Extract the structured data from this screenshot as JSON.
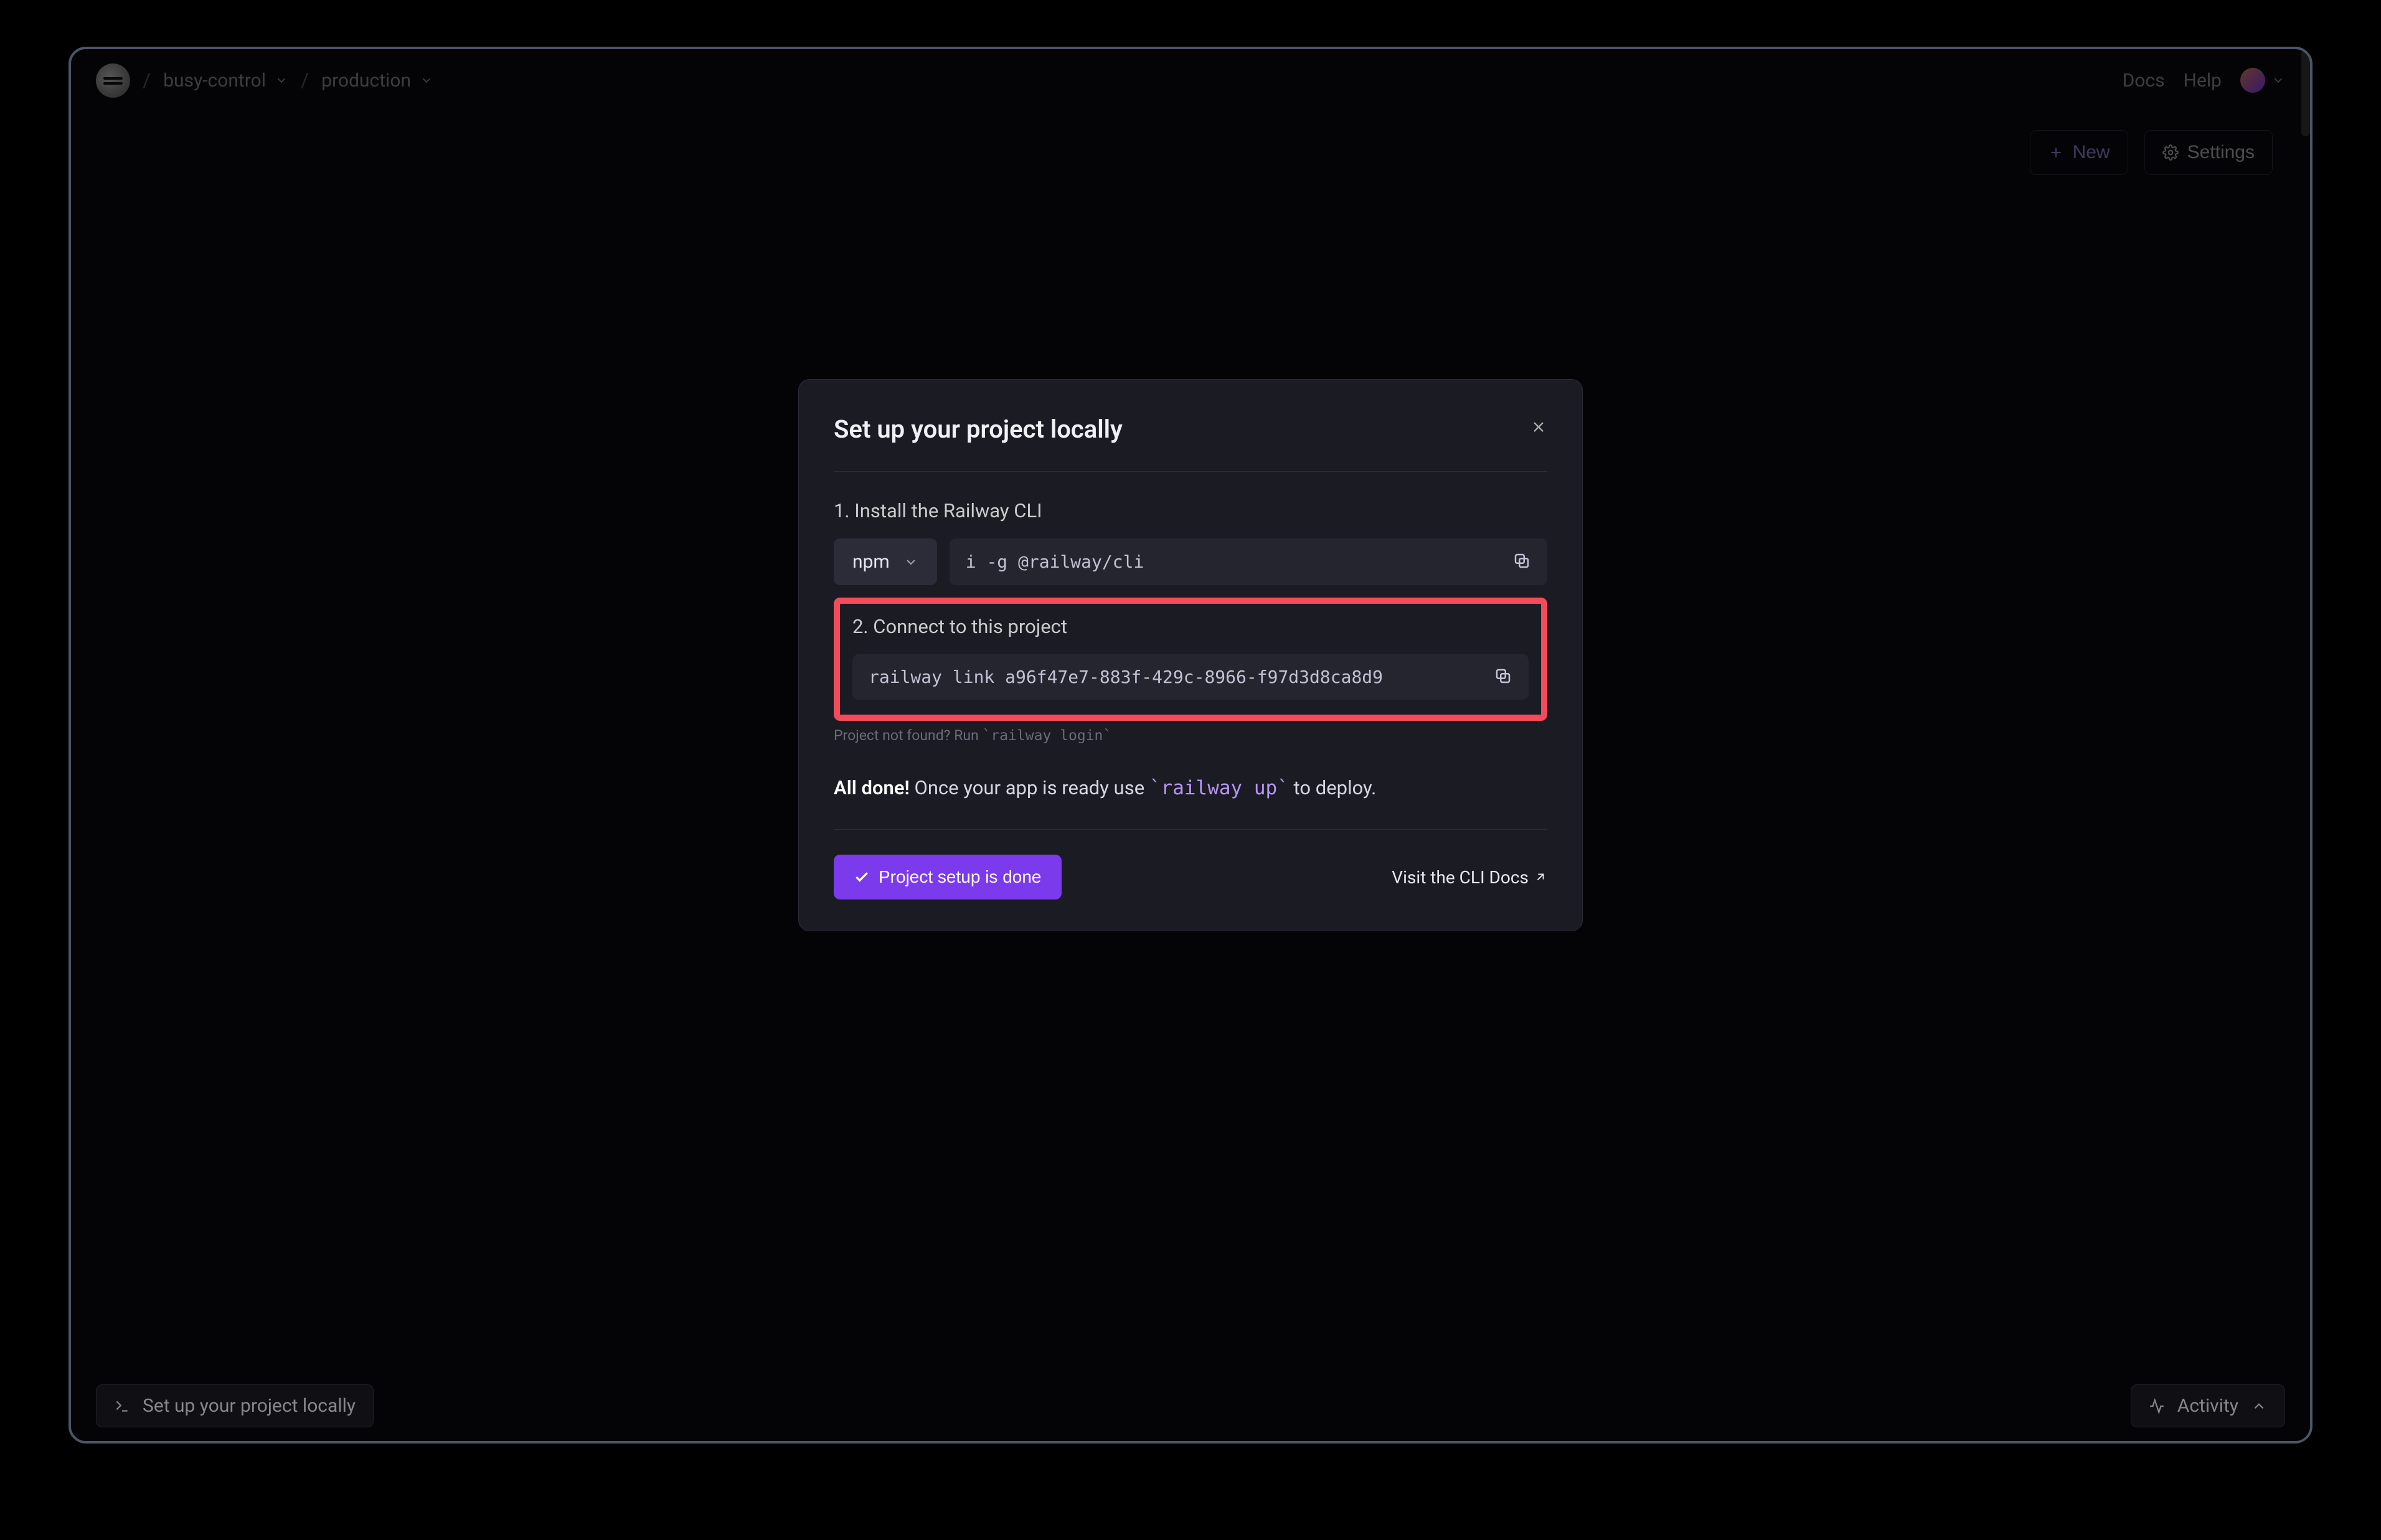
{
  "breadcrumbs": {
    "project": "busy-control",
    "environment": "production"
  },
  "nav": {
    "docs": "Docs",
    "help": "Help"
  },
  "actions": {
    "new": "New",
    "settings": "Settings"
  },
  "modal": {
    "title": "Set up your project locally",
    "step1_label": "1. Install the Railway CLI",
    "pkg_manager": "npm",
    "install_cmd": "i -g @railway/cli",
    "step2_label": "2. Connect to this project",
    "link_cmd": "railway link a96f47e7-883f-429c-8966-f97d3d8ca8d9",
    "hint_prefix": "Project not found? Run ",
    "hint_cmd": "`railway login`",
    "done_strong": "All done!",
    "done_text": " Once your app is ready use ",
    "done_cmd": "`railway up`",
    "done_suffix": " to deploy.",
    "btn_done": "Project setup is done",
    "link_docs": "Visit the CLI Docs"
  },
  "bottombar": {
    "left": "Set up your project locally",
    "right": "Activity"
  }
}
